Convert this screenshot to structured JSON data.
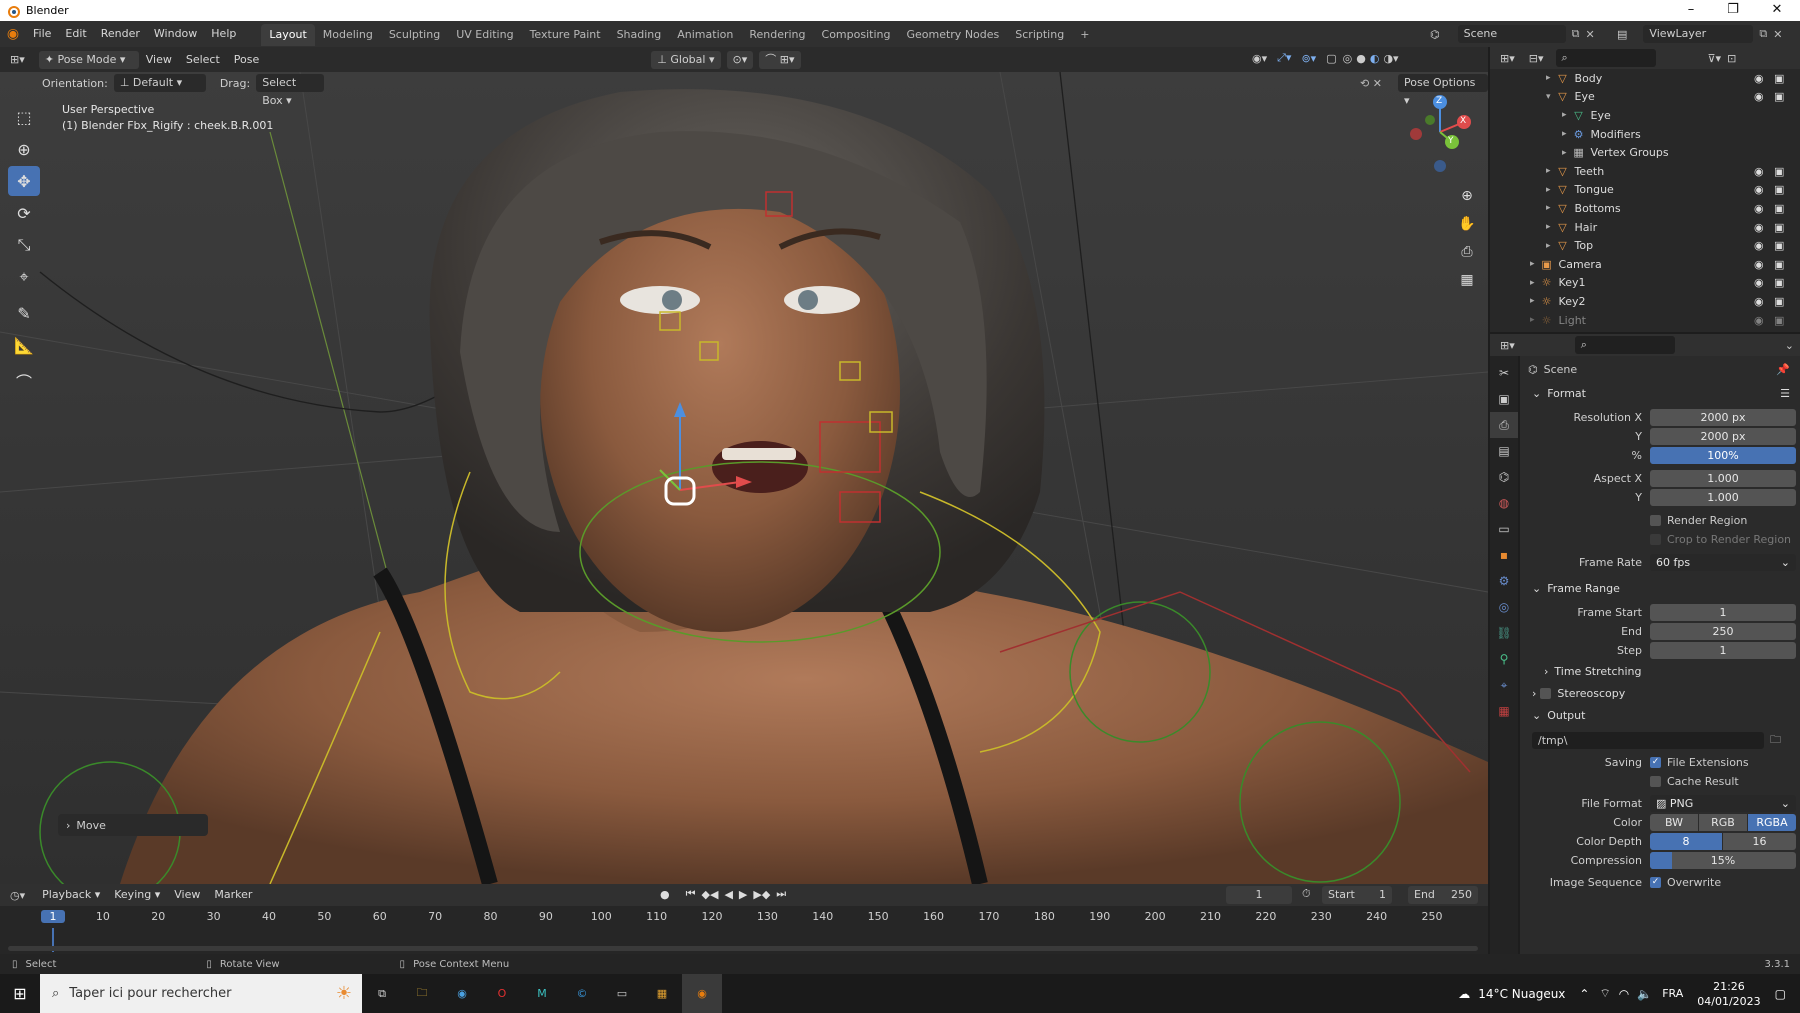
{
  "window": {
    "title": "Blender"
  },
  "menu": {
    "items": [
      "File",
      "Edit",
      "Render",
      "Window",
      "Help"
    ]
  },
  "workspaces": [
    "Layout",
    "Modeling",
    "Sculpting",
    "UV Editing",
    "Texture Paint",
    "Shading",
    "Animation",
    "Rendering",
    "Compositing",
    "Geometry Nodes",
    "Scripting"
  ],
  "scene": {
    "name": "Scene",
    "view_layer": "ViewLayer"
  },
  "viewport_header": {
    "mode": "Pose Mode",
    "menus": [
      "View",
      "Select",
      "Pose"
    ],
    "transform_orientation": "Global",
    "orientation_label": "Orientation:",
    "orientation_value": "Default",
    "drag_label": "Drag:",
    "drag_value": "Select Box",
    "pose_options": "Pose Options"
  },
  "viewport": {
    "perspective": "User Perspective",
    "active_object": "(1) Blender Fbx_Rigify : cheek.B.R.001",
    "last_operator": "Move",
    "gizmo_axes": [
      "X",
      "Y",
      "Z"
    ]
  },
  "outliner": {
    "items": [
      {
        "name": "Body",
        "icon": "triangle-mesh-icon"
      },
      {
        "name": "Eye",
        "icon": "triangle-mesh-icon"
      },
      {
        "name": "Eye",
        "icon": "mesh-data-icon"
      },
      {
        "name": "Modifiers",
        "icon": "wrench-icon"
      },
      {
        "name": "Vertex Groups",
        "icon": "vertex-groups-icon"
      },
      {
        "name": "Teeth",
        "icon": "triangle-mesh-icon"
      },
      {
        "name": "Tongue",
        "icon": "triangle-mesh-icon"
      },
      {
        "name": "Bottoms",
        "icon": "triangle-mesh-icon"
      },
      {
        "name": "Hair",
        "icon": "triangle-mesh-icon"
      },
      {
        "name": "Top",
        "icon": "triangle-mesh-icon"
      },
      {
        "name": "Camera",
        "icon": "camera-icon"
      },
      {
        "name": "Key1",
        "icon": "light-icon"
      },
      {
        "name": "Key2",
        "icon": "light-icon"
      },
      {
        "name": "Light",
        "icon": "light-icon"
      }
    ]
  },
  "properties": {
    "context": "Scene",
    "format": {
      "title": "Format",
      "resolution_x_label": "Resolution X",
      "resolution_x": "2000 px",
      "y_label": "Y",
      "resolution_y": "2000 px",
      "percent_label": "%",
      "percent": "100%",
      "aspect_x_label": "Aspect X",
      "aspect_x": "1.000",
      "aspect_y": "1.000",
      "render_region": "Render Region",
      "crop_region": "Crop to Render Region",
      "frame_rate_label": "Frame Rate",
      "frame_rate": "60 fps"
    },
    "frame_range": {
      "title": "Frame Range",
      "start_label": "Frame Start",
      "start": "1",
      "end_label": "End",
      "end": "250",
      "step_label": "Step",
      "step": "1"
    },
    "time_stretching": "Time Stretching",
    "stereoscopy": "Stereoscopy",
    "output": {
      "title": "Output",
      "path": "/tmp\\",
      "saving_label": "Saving",
      "file_extensions": "File Extensions",
      "cache_result": "Cache Result",
      "file_format_label": "File Format",
      "file_format": "PNG",
      "color_label": "Color",
      "color_options": [
        "BW",
        "RGB",
        "RGBA"
      ],
      "color_depth_label": "Color Depth",
      "color_depth_options": [
        "8",
        "16"
      ],
      "compression_label": "Compression",
      "compression": "15%",
      "compression_fraction": 0.15,
      "image_sequence_label": "Image Sequence",
      "overwrite": "Overwrite"
    }
  },
  "timeline": {
    "menus": [
      "Playback",
      "Keying",
      "View",
      "Marker"
    ],
    "current_frame": "1",
    "start_label": "Start",
    "start": "1",
    "end_label": "End",
    "end": "250",
    "ticks": [
      "1",
      "10",
      "20",
      "30",
      "40",
      "50",
      "60",
      "70",
      "80",
      "90",
      "100",
      "110",
      "120",
      "130",
      "140",
      "150",
      "160",
      "170",
      "180",
      "190",
      "200",
      "210",
      "220",
      "230",
      "240",
      "250"
    ]
  },
  "statusbar": {
    "select": "Select",
    "rotate": "Rotate View",
    "context_menu": "Pose Context Menu",
    "version": "3.3.1"
  },
  "taskbar": {
    "search_placeholder": "Taper ici pour rechercher",
    "weather": "14°C  Nuageux",
    "language": "FRA",
    "time": "21:26",
    "date": "04/01/2023"
  },
  "colors": {
    "accent": "#4772b3",
    "header": "#303030",
    "panel": "#2b2b2b",
    "selected_bone": "#ffffff"
  }
}
